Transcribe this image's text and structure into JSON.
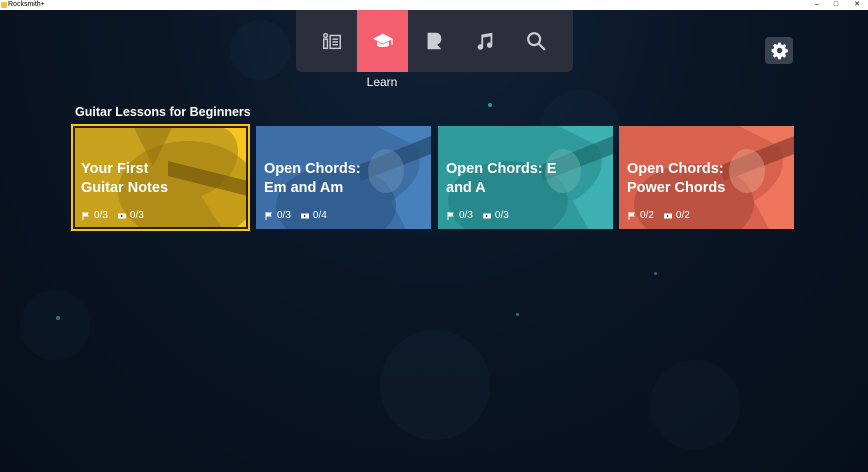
{
  "window": {
    "title": "Rocksmith+",
    "minimize": "–",
    "maximize": "□",
    "close": "✕"
  },
  "nav": {
    "items": [
      {
        "id": "home",
        "icon": "setlist-icon"
      },
      {
        "id": "learn",
        "icon": "graduation-cap-icon",
        "active": true
      },
      {
        "id": "rocksmith",
        "icon": "rocksmith-r-icon"
      },
      {
        "id": "songs",
        "icon": "music-note-icon"
      },
      {
        "id": "search",
        "icon": "search-icon"
      }
    ],
    "active_label": "Learn",
    "active_color": "#f35f6f"
  },
  "settings": {
    "icon": "gear-icon"
  },
  "section": {
    "title": "Guitar Lessons for Beginners"
  },
  "cards": [
    {
      "title": "Your First\nGuitar Notes",
      "lessons": "0/3",
      "videos": "0/3",
      "color": "#c9a21d",
      "selected": true
    },
    {
      "title": "Open Chords:\nEm and Am",
      "lessons": "0/3",
      "videos": "0/4",
      "color": "#3d6fa6",
      "selected": false
    },
    {
      "title": "Open Chords: E\nand A",
      "lessons": "0/3",
      "videos": "0/3",
      "color": "#2f9a9c",
      "selected": false
    },
    {
      "title": "Open Chords:\nPower Chords",
      "lessons": "0/2",
      "videos": "0/2",
      "color": "#d9624e",
      "selected": false
    }
  ]
}
